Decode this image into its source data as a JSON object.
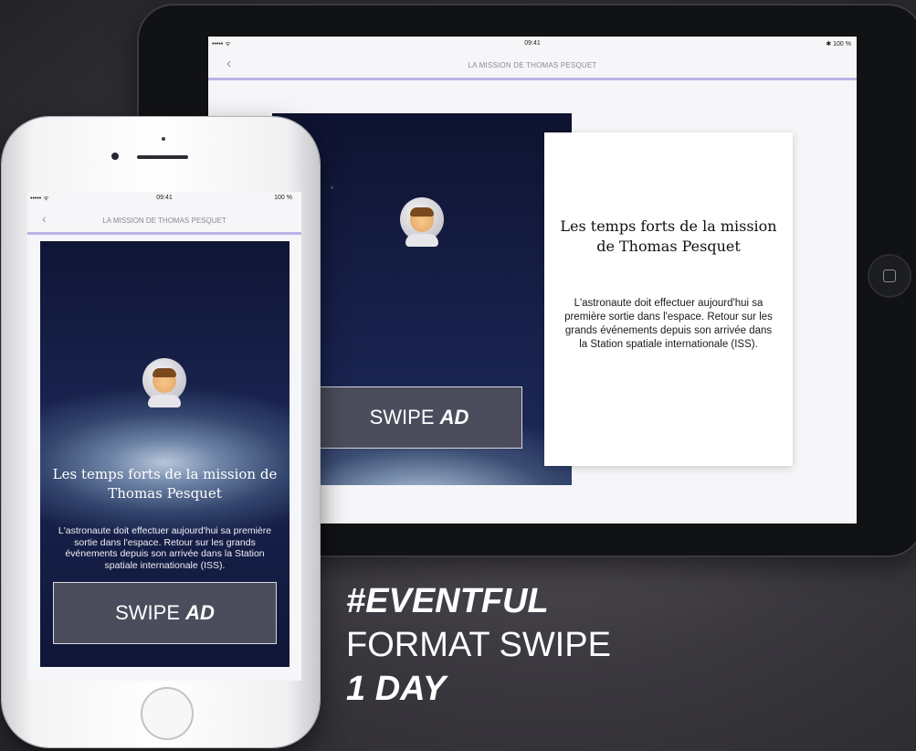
{
  "device_status": {
    "carrier": "••••• ᯤ",
    "time": "09:41",
    "ipad_battery": "✱ 100 %",
    "iphone_battery": "100 %"
  },
  "nav": {
    "title": "LA MISSION DE THOMAS PESQUET",
    "back": "‹"
  },
  "article": {
    "title": "Les temps forts de la mission de Thomas Pesquet",
    "description": "L'astronaute doit effectuer aujourd'hui sa première sortie dans l'espace. Retour sur les grands événements depuis son arrivée dans la Station spatiale internationale (ISS)."
  },
  "cta": {
    "label_plain": "SWIPE",
    "label_bold": "AD"
  },
  "tagline": {
    "line1": "#EVENTFUL",
    "line2": "FORMAT SWIPE",
    "line3": "1 DAY"
  },
  "icons": {
    "astronaut": "astronaut-icon",
    "home": "home-button-icon"
  }
}
